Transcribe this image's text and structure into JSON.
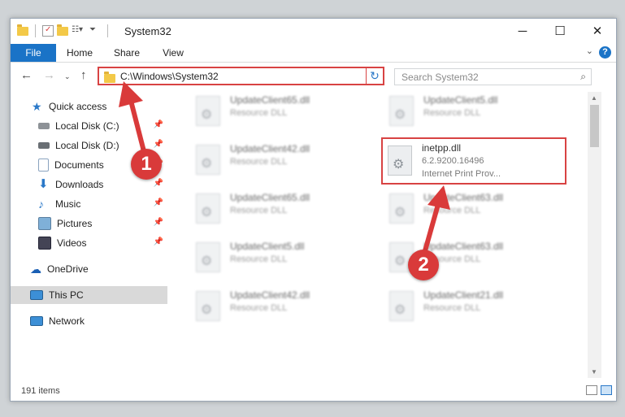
{
  "window": {
    "title": "System32",
    "controls": {
      "minimize": "─",
      "maximize": "☐",
      "close": "✕"
    }
  },
  "ribbon": {
    "tabs": [
      "File",
      "Home",
      "Share",
      "View"
    ],
    "help": "?"
  },
  "address": {
    "path": "C:\\Windows\\System32",
    "refresh": "↻"
  },
  "search": {
    "placeholder": "Search System32"
  },
  "sidebar": {
    "items": [
      {
        "label": "Quick access",
        "icon": "star-icon",
        "pinned": false
      },
      {
        "label": "Local Disk (C:)",
        "icon": "drive-icon",
        "pinned": true
      },
      {
        "label": "Local Disk (D:)",
        "icon": "drive-icon",
        "pinned": true
      },
      {
        "label": "Documents",
        "icon": "documents-icon",
        "pinned": true
      },
      {
        "label": "Downloads",
        "icon": "download-icon",
        "pinned": true
      },
      {
        "label": "Music",
        "icon": "music-icon",
        "pinned": true
      },
      {
        "label": "Pictures",
        "icon": "pictures-icon",
        "pinned": true
      },
      {
        "label": "Videos",
        "icon": "videos-icon",
        "pinned": true
      },
      {
        "label": "OneDrive",
        "icon": "cloud-icon",
        "pinned": false
      },
      {
        "label": "This PC",
        "icon": "computer-icon",
        "pinned": false,
        "selected": true
      },
      {
        "label": "Network",
        "icon": "network-icon",
        "pinned": false
      }
    ]
  },
  "files": {
    "left": [
      {
        "name": "UpdateClient65.dll",
        "type": "Resource DLL"
      },
      {
        "name": "UpdateClient42.dll",
        "type": "Resource DLL"
      },
      {
        "name": "UpdateClient65.dll",
        "type": "Resource DLL"
      },
      {
        "name": "UpdateClient5.dll",
        "type": "Resource DLL"
      },
      {
        "name": "UpdateClient42.dll",
        "type": "Resource DLL"
      }
    ],
    "right": [
      {
        "name": "UpdateClient5.dll",
        "type": "Resource DLL"
      },
      {
        "name": "inetpp.dll",
        "version": "6.2.9200.16496",
        "type": "Internet Print Prov...",
        "highlighted": true
      },
      {
        "name": "UpdateClient63.dll",
        "type": "Resource DLL"
      },
      {
        "name": "UpdateClient63.dll",
        "type": "Resource DLL"
      },
      {
        "name": "UpdateClient21.dll",
        "type": "Resource DLL"
      }
    ]
  },
  "status": {
    "count": "191 items"
  },
  "annotations": {
    "step1": "1",
    "step2": "2",
    "color": "#d93a3a"
  }
}
